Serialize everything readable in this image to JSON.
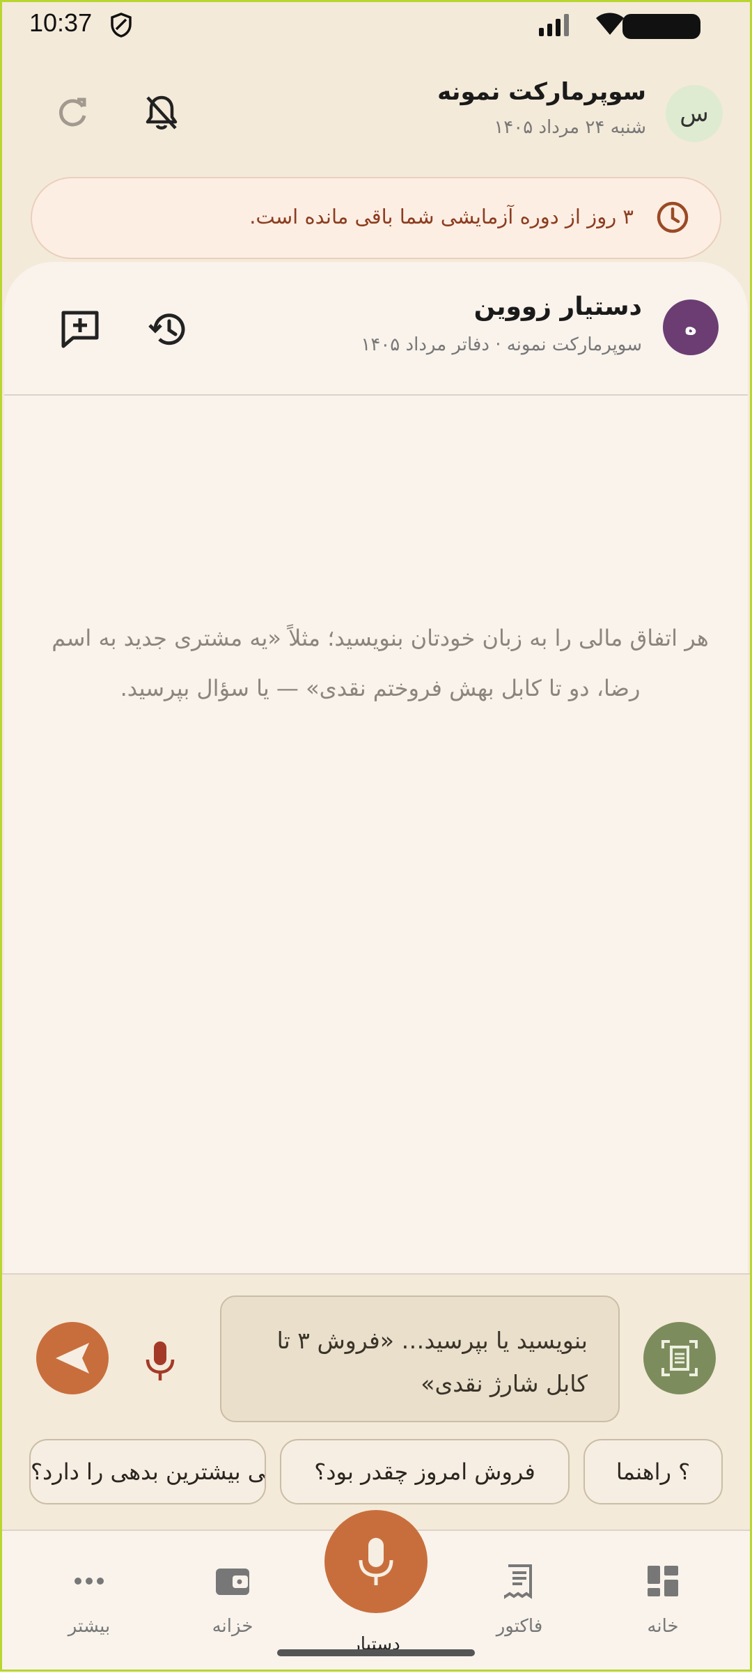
{
  "status_bar": {
    "time": "10:37"
  },
  "header": {
    "avatar_letter": "س",
    "store_name": "سوپرمارکت نمونه",
    "date": "شنبه ۲۴ مرداد ۱۴۰۵"
  },
  "trial_banner": {
    "text": "۳ روز از دوره آزمایشی شما باقی مانده است."
  },
  "assistant": {
    "avatar_letter": "ە",
    "name": "دستیار زووین",
    "subtitle": "سوپرمارکت نمونه · دفاتر مرداد ۱۴۰۵",
    "empty_hint": "هر اتفاق مالی را به زبان خودتان بنویسید؛ مثلاً «یه مشتری جدید به اسم رضا، دو تا کابل بهش فروختم نقدی» — یا سؤال بپرسید."
  },
  "composer": {
    "placeholder": "بنویسید یا بپرسید…  «فروش ۳ تا کابل شارژ نقدی»"
  },
  "chips": [
    {
      "label": "؟ راهنما"
    },
    {
      "label": "فروش امروز چقدر بود؟"
    },
    {
      "label": "چه کسی بیشترین بدهی را دارد؟"
    }
  ],
  "nav": {
    "home": "خانه",
    "invoice": "فاکتور",
    "assistant": "دستیار",
    "treasury": "خزانه",
    "more": "بیشتر"
  },
  "colors": {
    "accent": "#c86e3d",
    "assistant_avatar": "#6b3d73",
    "scan_button": "#7d8c5c",
    "background": "#f4ead9"
  }
}
